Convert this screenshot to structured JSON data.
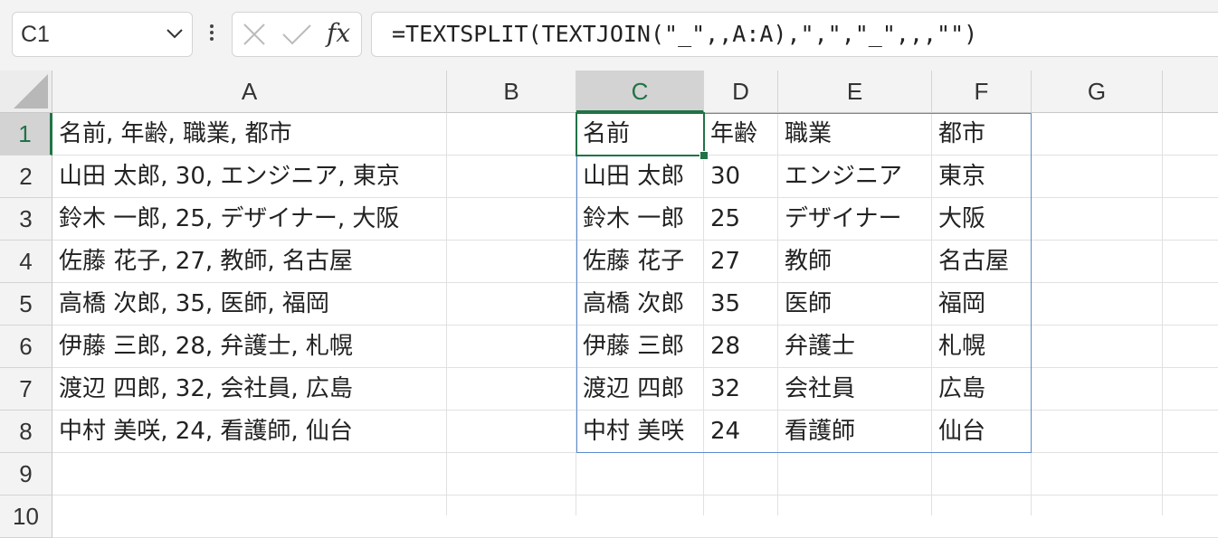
{
  "name_box": {
    "value": "C1"
  },
  "formula_bar": {
    "cancel_icon": "x-icon",
    "enter_icon": "check-icon",
    "fx_label": "fx",
    "formula": "=TEXTSPLIT(TEXTJOIN(\"_\",,A:A),\",\",\"_\",,,\"\")"
  },
  "columns": [
    "A",
    "B",
    "C",
    "D",
    "E",
    "F",
    "G"
  ],
  "selected_column": "C",
  "rows": [
    "1",
    "2",
    "3",
    "4",
    "5",
    "6",
    "7",
    "8",
    "9",
    "10"
  ],
  "selected_row": "1",
  "column_a": [
    "名前, 年齢, 職業, 都市",
    "山田 太郎, 30, エンジニア, 東京",
    "鈴木 一郎, 25, デザイナー, 大阪",
    "佐藤 花子, 27, 教師, 名古屋",
    "高橋 次郎, 35, 医師, 福岡",
    "伊藤 三郎, 28, 弁護士, 札幌",
    "渡辺 四郎, 32, 会社員, 広島",
    "中村 美咲, 24, 看護師, 仙台"
  ],
  "spill_table": [
    [
      "名前",
      "年齢",
      "職業",
      "都市"
    ],
    [
      "山田 太郎",
      "30",
      "エンジニア",
      "東京"
    ],
    [
      "鈴木 一郎",
      "25",
      "デザイナー",
      "大阪"
    ],
    [
      "佐藤 花子",
      "27",
      "教師",
      "名古屋"
    ],
    [
      "高橋 次郎",
      "35",
      "医師",
      "福岡"
    ],
    [
      "伊藤 三郎",
      "28",
      "弁護士",
      "札幌"
    ],
    [
      "渡辺 四郎",
      "32",
      "会社員",
      "広島"
    ],
    [
      "中村 美咲",
      "24",
      "看護師",
      "仙台"
    ]
  ],
  "colors": {
    "accent": "#217346",
    "spill_border": "#5b8bd0"
  }
}
